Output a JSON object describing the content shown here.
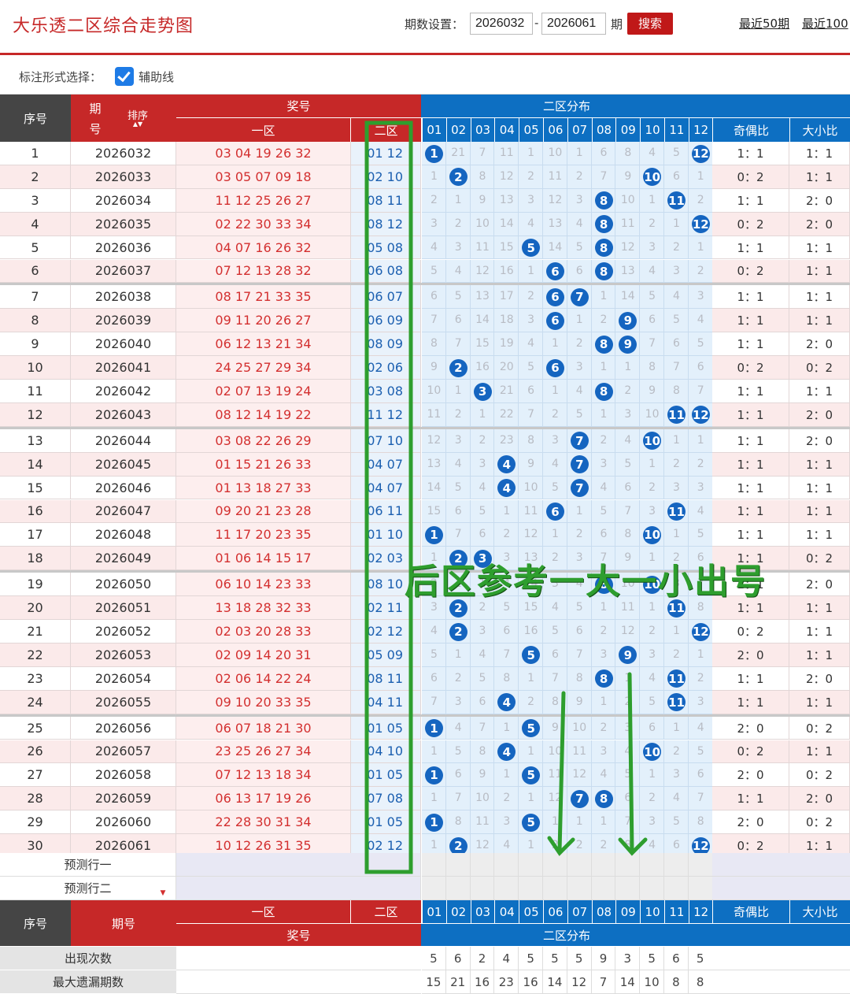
{
  "app_title": "大乐透二区综合走势图",
  "period": {
    "label": "期数设置：",
    "from": "2026032",
    "to": "2026061",
    "suffix": "期",
    "search": "搜索"
  },
  "recent_links": [
    "最近50期",
    "最近100"
  ],
  "options": {
    "label": "标注形式选择：",
    "checkbox_label": "辅助线",
    "checked": true
  },
  "header": {
    "seq": "序号",
    "period": "期",
    "period2": "号",
    "sort": "排序",
    "prize": "奖号",
    "zone1": "一区",
    "zone2": "二区",
    "dist": "二区分布",
    "odd_even": "奇偶比",
    "big_small": "大小比",
    "cols": [
      "01",
      "02",
      "03",
      "04",
      "05",
      "06",
      "07",
      "08",
      "09",
      "10",
      "11",
      "12"
    ]
  },
  "rows": [
    {
      "seq": "1",
      "period": "2026032",
      "front": "03 04 19 26 32",
      "back": "01 12",
      "cells": [
        "1",
        "21",
        "7",
        "11",
        "1",
        "10",
        "1",
        "6",
        "8",
        "4",
        "5",
        "12"
      ],
      "oe": "1：1",
      "bs": "1：1"
    },
    {
      "seq": "2",
      "period": "2026033",
      "front": "03 05 07 09 18",
      "back": "02 10",
      "cells": [
        "1",
        "2",
        "8",
        "12",
        "2",
        "11",
        "2",
        "7",
        "9",
        "10",
        "6",
        "1"
      ],
      "oe": "0：2",
      "bs": "1：1"
    },
    {
      "seq": "3",
      "period": "2026034",
      "front": "11 12 25 26 27",
      "back": "08 11",
      "cells": [
        "2",
        "1",
        "9",
        "13",
        "3",
        "12",
        "3",
        "8",
        "10",
        "1",
        "11",
        "2"
      ],
      "oe": "1：1",
      "bs": "2：0"
    },
    {
      "seq": "4",
      "period": "2026035",
      "front": "02 22 30 33 34",
      "back": "08 12",
      "cells": [
        "3",
        "2",
        "10",
        "14",
        "4",
        "13",
        "4",
        "8",
        "11",
        "2",
        "1",
        "12"
      ],
      "oe": "0：2",
      "bs": "2：0"
    },
    {
      "seq": "5",
      "period": "2026036",
      "front": "04 07 16 26 32",
      "back": "05 08",
      "cells": [
        "4",
        "3",
        "11",
        "15",
        "5",
        "14",
        "5",
        "8",
        "12",
        "3",
        "2",
        "1"
      ],
      "oe": "1：1",
      "bs": "1：1"
    },
    {
      "seq": "6",
      "period": "2026037",
      "front": "07 12 13 28 32",
      "back": "06 08",
      "cells": [
        "5",
        "4",
        "12",
        "16",
        "1",
        "6",
        "6",
        "8",
        "13",
        "4",
        "3",
        "2"
      ],
      "oe": "0：2",
      "bs": "1：1"
    },
    {
      "seq": "7",
      "period": "2026038",
      "front": "08 17 21 33 35",
      "back": "06 07",
      "cells": [
        "6",
        "5",
        "13",
        "17",
        "2",
        "6",
        "7",
        "1",
        "14",
        "5",
        "4",
        "3"
      ],
      "oe": "1：1",
      "bs": "1：1"
    },
    {
      "seq": "8",
      "period": "2026039",
      "front": "09 11 20 26 27",
      "back": "06 09",
      "cells": [
        "7",
        "6",
        "14",
        "18",
        "3",
        "6",
        "1",
        "2",
        "9",
        "6",
        "5",
        "4"
      ],
      "oe": "1：1",
      "bs": "1：1"
    },
    {
      "seq": "9",
      "period": "2026040",
      "front": "06 12 13 21 34",
      "back": "08 09",
      "cells": [
        "8",
        "7",
        "15",
        "19",
        "4",
        "1",
        "2",
        "8",
        "9",
        "7",
        "6",
        "5"
      ],
      "oe": "1：1",
      "bs": "2：0"
    },
    {
      "seq": "10",
      "period": "2026041",
      "front": "24 25 27 29 34",
      "back": "02 06",
      "cells": [
        "9",
        "2",
        "16",
        "20",
        "5",
        "6",
        "3",
        "1",
        "1",
        "8",
        "7",
        "6"
      ],
      "oe": "0：2",
      "bs": "0：2"
    },
    {
      "seq": "11",
      "period": "2026042",
      "front": "02 07 13 19 24",
      "back": "03 08",
      "cells": [
        "10",
        "1",
        "3",
        "21",
        "6",
        "1",
        "4",
        "8",
        "2",
        "9",
        "8",
        "7"
      ],
      "oe": "1：1",
      "bs": "1：1"
    },
    {
      "seq": "12",
      "period": "2026043",
      "front": "08 12 14 19 22",
      "back": "11 12",
      "cells": [
        "11",
        "2",
        "1",
        "22",
        "7",
        "2",
        "5",
        "1",
        "3",
        "10",
        "11",
        "12"
      ],
      "oe": "1：1",
      "bs": "2：0"
    },
    {
      "seq": "13",
      "period": "2026044",
      "front": "03 08 22 26 29",
      "back": "07 10",
      "cells": [
        "12",
        "3",
        "2",
        "23",
        "8",
        "3",
        "7",
        "2",
        "4",
        "10",
        "1",
        "1"
      ],
      "oe": "1：1",
      "bs": "2：0"
    },
    {
      "seq": "14",
      "period": "2026045",
      "front": "01 15 21 26 33",
      "back": "04 07",
      "cells": [
        "13",
        "4",
        "3",
        "4",
        "9",
        "4",
        "7",
        "3",
        "5",
        "1",
        "2",
        "2"
      ],
      "oe": "1：1",
      "bs": "1：1"
    },
    {
      "seq": "15",
      "period": "2026046",
      "front": "01 13 18 27 33",
      "back": "04 07",
      "cells": [
        "14",
        "5",
        "4",
        "4",
        "10",
        "5",
        "7",
        "4",
        "6",
        "2",
        "3",
        "3"
      ],
      "oe": "1：1",
      "bs": "1：1"
    },
    {
      "seq": "16",
      "period": "2026047",
      "front": "09 20 21 23 28",
      "back": "06 11",
      "cells": [
        "15",
        "6",
        "5",
        "1",
        "11",
        "6",
        "1",
        "5",
        "7",
        "3",
        "11",
        "4"
      ],
      "oe": "1：1",
      "bs": "1：1"
    },
    {
      "seq": "17",
      "period": "2026048",
      "front": "11 17 20 23 35",
      "back": "01 10",
      "cells": [
        "1",
        "7",
        "6",
        "2",
        "12",
        "1",
        "2",
        "6",
        "8",
        "10",
        "1",
        "5"
      ],
      "oe": "1：1",
      "bs": "1：1"
    },
    {
      "seq": "18",
      "period": "2026049",
      "front": "01 06 14 15 17",
      "back": "02 03",
      "cells": [
        "1",
        "2",
        "3",
        "3",
        "13",
        "2",
        "3",
        "7",
        "9",
        "1",
        "2",
        "6"
      ],
      "oe": "1：1",
      "bs": "0：2"
    },
    {
      "seq": "19",
      "period": "2026050",
      "front": "06 10 14 23 33",
      "back": "08 10",
      "cells": [
        "2",
        "1",
        "1",
        "4",
        "14",
        "3",
        "4",
        "8",
        "10",
        "10",
        "3",
        "7"
      ],
      "oe": "1：1",
      "bs": "2：0"
    },
    {
      "seq": "20",
      "period": "2026051",
      "front": "13 18 28 32 33",
      "back": "02 11",
      "cells": [
        "3",
        "2",
        "2",
        "5",
        "15",
        "4",
        "5",
        "1",
        "11",
        "1",
        "11",
        "8"
      ],
      "oe": "1：1",
      "bs": "1：1"
    },
    {
      "seq": "21",
      "period": "2026052",
      "front": "02 03 20 28 33",
      "back": "02 12",
      "cells": [
        "4",
        "2",
        "3",
        "6",
        "16",
        "5",
        "6",
        "2",
        "12",
        "2",
        "1",
        "12"
      ],
      "oe": "0：2",
      "bs": "1：1"
    },
    {
      "seq": "22",
      "period": "2026053",
      "front": "02 09 14 20 31",
      "back": "05 09",
      "cells": [
        "5",
        "1",
        "4",
        "7",
        "5",
        "6",
        "7",
        "3",
        "9",
        "3",
        "2",
        "1"
      ],
      "oe": "2：0",
      "bs": "1：1"
    },
    {
      "seq": "23",
      "period": "2026054",
      "front": "02 06 14 22 24",
      "back": "08 11",
      "cells": [
        "6",
        "2",
        "5",
        "8",
        "1",
        "7",
        "8",
        "8",
        "1",
        "4",
        "11",
        "2"
      ],
      "oe": "1：1",
      "bs": "2：0"
    },
    {
      "seq": "24",
      "period": "2026055",
      "front": "09 10 20 33 35",
      "back": "04 11",
      "cells": [
        "7",
        "3",
        "6",
        "4",
        "2",
        "8",
        "9",
        "1",
        "2",
        "5",
        "11",
        "3"
      ],
      "oe": "1：1",
      "bs": "1：1"
    },
    {
      "seq": "25",
      "period": "2026056",
      "front": "06 07 18 21 30",
      "back": "01 05",
      "cells": [
        "1",
        "4",
        "7",
        "1",
        "5",
        "9",
        "10",
        "2",
        "3",
        "6",
        "1",
        "4"
      ],
      "oe": "2：0",
      "bs": "0：2"
    },
    {
      "seq": "26",
      "period": "2026057",
      "front": "23 25 26 27 34",
      "back": "04 10",
      "cells": [
        "1",
        "5",
        "8",
        "4",
        "1",
        "10",
        "11",
        "3",
        "4",
        "10",
        "2",
        "5"
      ],
      "oe": "0：2",
      "bs": "1：1"
    },
    {
      "seq": "27",
      "period": "2026058",
      "front": "07 12 13 18 34",
      "back": "01 05",
      "cells": [
        "1",
        "6",
        "9",
        "1",
        "5",
        "11",
        "12",
        "4",
        "5",
        "1",
        "3",
        "6"
      ],
      "oe": "2：0",
      "bs": "0：2"
    },
    {
      "seq": "28",
      "period": "2026059",
      "front": "06 13 17 19 26",
      "back": "07 08",
      "cells": [
        "1",
        "7",
        "10",
        "2",
        "1",
        "12",
        "7",
        "8",
        "6",
        "2",
        "4",
        "7"
      ],
      "oe": "1：1",
      "bs": "2：0"
    },
    {
      "seq": "29",
      "period": "2026060",
      "front": "22 28 30 31 34",
      "back": "01 05",
      "cells": [
        "1",
        "8",
        "11",
        "3",
        "5",
        "1",
        "1",
        "1",
        "7",
        "3",
        "5",
        "8"
      ],
      "oe": "2：0",
      "bs": "0：2"
    },
    {
      "seq": "30",
      "period": "2026061",
      "front": "10 12 26 31 35",
      "back": "02 12",
      "cells": [
        "1",
        "2",
        "12",
        "4",
        "1",
        "2",
        "2",
        "2",
        "8",
        "4",
        "6",
        "12"
      ],
      "oe": "0：2",
      "bs": "1：1"
    }
  ],
  "predict": [
    "预测行一",
    "预测行二"
  ],
  "footer": {
    "seq": "序号",
    "period": "期号",
    "zone1": "一区",
    "zone2": "二区",
    "prize": "奖号",
    "dist": "二区分布",
    "odd_even": "奇偶比",
    "big_small": "大小比",
    "count_label": "出现次数",
    "max_label": "最大遗漏期数",
    "counts": [
      "5",
      "6",
      "2",
      "4",
      "5",
      "5",
      "5",
      "9",
      "3",
      "5",
      "6",
      "5"
    ],
    "max_miss": [
      "15",
      "21",
      "16",
      "23",
      "16",
      "14",
      "12",
      "7",
      "14",
      "10",
      "8",
      "8"
    ]
  },
  "annotation": "后区参考一大一小出号",
  "colors": {
    "red": "#c62828",
    "blue": "#0d6fc2",
    "ball": "#1565c0",
    "green": "#2e9e2e"
  }
}
